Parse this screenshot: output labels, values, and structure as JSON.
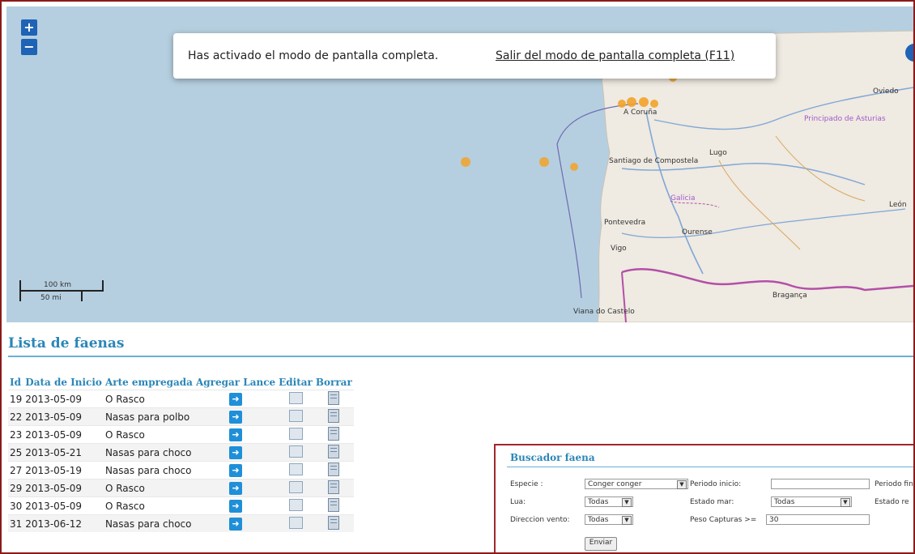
{
  "map": {
    "zoom_in": "+",
    "zoom_out": "−",
    "fullscreen_message": "Has activado el modo de pantalla completa.",
    "fullscreen_exit": "Salir del modo de pantalla completa (F11)",
    "scale_top": "100 km",
    "scale_bottom": "50 mi",
    "places": {
      "acoruna": "A Coruña",
      "asturias": "Principado de Asturias",
      "santiago": "Santiago de Compostela",
      "lugo": "Lugo",
      "galicia": "Galicia",
      "pontevedra": "Pontevedra",
      "ourense": "Ourense",
      "vigo": "Vigo",
      "leon": "León",
      "braganca": "Bragança",
      "viana": "Viana do Castelo",
      "oviedo": "Oviedo"
    },
    "colors": {
      "sea": "#b5cfe0",
      "land": "#efeae2",
      "marker": "#f2a32a"
    }
  },
  "list": {
    "title": "Lista de faenas",
    "headers": [
      "Id",
      "Data de Inicio",
      "Arte empregada",
      "Agregar Lance",
      "Editar",
      "Borrar"
    ],
    "rows": [
      {
        "id": "19",
        "date": "2013-05-09",
        "arte": "O Rasco"
      },
      {
        "id": "22",
        "date": "2013-05-09",
        "arte": "Nasas para polbo"
      },
      {
        "id": "23",
        "date": "2013-05-09",
        "arte": "O Rasco"
      },
      {
        "id": "25",
        "date": "2013-05-21",
        "arte": "Nasas para choco"
      },
      {
        "id": "27",
        "date": "2013-05-19",
        "arte": "Nasas para choco"
      },
      {
        "id": "29",
        "date": "2013-05-09",
        "arte": "O Rasco"
      },
      {
        "id": "30",
        "date": "2013-05-09",
        "arte": "O Rasco"
      },
      {
        "id": "31",
        "date": "2013-06-12",
        "arte": "Nasas para choco"
      }
    ]
  },
  "buscador": {
    "title": "Buscador faena",
    "especie_label": "Especie :",
    "especie_value": "Conger conger",
    "periodo_inicio_label": "Periodo inicio:",
    "periodo_inicio_value": "",
    "periodo_fin_label": "Periodo fin",
    "lua_label": "Lua:",
    "lua_value": "Todas",
    "estado_mar_label": "Estado mar:",
    "estado_mar_value": "Todas",
    "estado_re_label": "Estado re",
    "direccion_vento_label": "Direccion vento:",
    "direccion_vento_value": "Todas",
    "peso_label": "Peso Capturas >=",
    "peso_value": "30",
    "submit": "Enviar"
  }
}
